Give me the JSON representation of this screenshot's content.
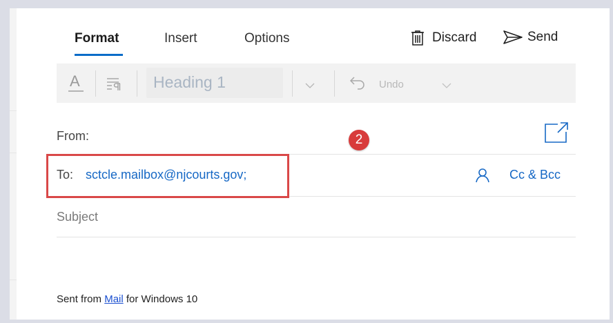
{
  "tabs": [
    {
      "label": "Format",
      "active": true
    },
    {
      "label": "Insert",
      "active": false
    },
    {
      "label": "Options",
      "active": false
    }
  ],
  "commands": {
    "discard_label": "Discard",
    "discard_icon": "trash-icon",
    "send_label": "Send",
    "send_icon": "paper-plane-icon"
  },
  "toolbar": {
    "font_color_icon": "font-color-icon",
    "paragraph_icon": "paragraph-format-icon",
    "style_value": "Heading 1",
    "undo_label": "Undo"
  },
  "fields": {
    "from_label": "From:",
    "to_label": "To:",
    "to_value": "sctcle.mailbox@njcourts.gov;",
    "subject_placeholder": "Subject",
    "cc_bcc_label": "Cc & Bcc",
    "popout_icon": "pop-out-icon",
    "contact_icon": "person-icon"
  },
  "annotation": {
    "step": "2",
    "color": "#d83b3b"
  },
  "signature": {
    "prefix": "Sent from ",
    "link": "Mail",
    "suffix": " for Windows 10"
  },
  "colors": {
    "accent": "#0a6cc8",
    "link": "#1668c5",
    "highlight": "#d94848"
  }
}
